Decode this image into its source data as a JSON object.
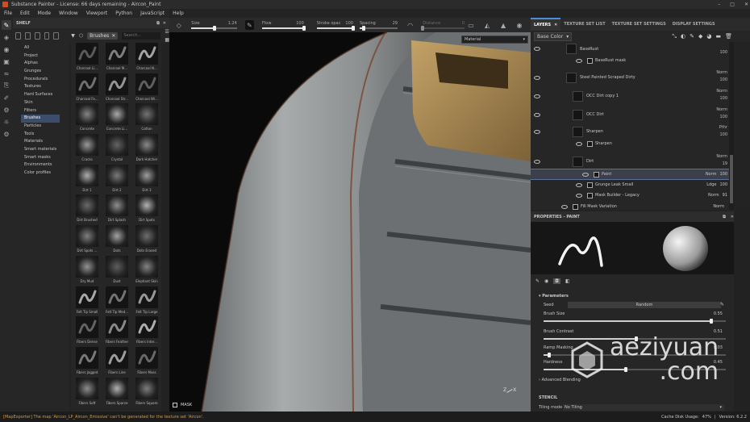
{
  "window": {
    "title": "Substance Painter - License: 66 days remaining - Aircon_Paint",
    "controls": [
      "–",
      "□",
      "✕"
    ]
  },
  "menu": [
    "File",
    "Edit",
    "Mode",
    "Window",
    "Viewport",
    "Python",
    "JavaScript",
    "Help"
  ],
  "toolbar": {
    "size": {
      "label": "Size",
      "value": "1.24",
      "fill": 0.5
    },
    "flow": {
      "label": "Flow",
      "value": "100",
      "fill": 1.0
    },
    "stroke_opacity": {
      "label": "Stroke opac",
      "value": "100",
      "fill": 1.0
    },
    "spacing": {
      "label": "Spacing",
      "value": "29",
      "fill": 0.1
    },
    "distance": {
      "label": "Distance",
      "value": "0",
      "fill": 0.0
    }
  },
  "shelf": {
    "title": "SHELF",
    "filter_chip": "Brushes",
    "search_placeholder": "Search...",
    "categories": [
      "All",
      "Project",
      "Alphas",
      "Grunges",
      "Procedurals",
      "Textures",
      "Hard Surfaces",
      "Skin",
      "Filters",
      "Brushes",
      "Particles",
      "Tools",
      "Materials",
      "Smart materials",
      "Smart masks",
      "Environments",
      "Color profiles"
    ],
    "selected_category": "Brushes",
    "brushes": [
      "Charcoal Li...",
      "Charcoal M...",
      "Charcoal N...",
      "Charcoal Fa...",
      "Charcoal Str...",
      "Charcoal Wi...",
      "Concrete",
      "Concrete Li...",
      "Cotton",
      "Cracks",
      "Crystal",
      "Dark Hatcher",
      "Dirt 1",
      "Dirt 2",
      "Dirt 3",
      "Dirt Brushed",
      "Dirt Splash",
      "Dirt Spots",
      "Dirt Spots ...",
      "Dots",
      "Dots Erased",
      "Dry Mud",
      "Dust",
      "Elephant Skin",
      "Felt Tip Small",
      "Felt Tip Med...",
      "Felt Tip Large",
      "Fibers Dense",
      "Fibers Feather",
      "Fibers Inter...",
      "Fibers Jagged",
      "Fibers Line",
      "Fibers Moss",
      "Fibers Soft",
      "Fibers Sparse",
      "Fibers Square"
    ]
  },
  "viewport": {
    "channel_select": "Material",
    "mask_label": "MASK",
    "axis_z": "Z",
    "axis_x": "X"
  },
  "layers_panel": {
    "tabs": [
      "LAYERS",
      "TEXTURE SET LIST",
      "TEXTURE SET SETTINGS",
      "DISPLAY SETTINGS"
    ],
    "channel": "Base Color",
    "layers": [
      {
        "name": "BaseRust",
        "mode": "",
        "opacity": "100"
      },
      {
        "name": "BaseRust mask",
        "mode": "",
        "opacity": ""
      },
      {
        "name": "Steel Painted Scraped Dirty",
        "mode": "Norm",
        "opacity": "100"
      },
      {
        "name": "OCC Dirt copy 1",
        "mode": "Norm",
        "opacity": "100"
      },
      {
        "name": "OCC Dirt",
        "mode": "Norm",
        "opacity": "100"
      },
      {
        "name": "Sharpen",
        "mode": "Pthr",
        "opacity": "100"
      },
      {
        "name": "Sharpen",
        "mode": "",
        "opacity": ""
      },
      {
        "name": "Dirt",
        "mode": "Norm",
        "opacity": "19"
      },
      {
        "name": "Paint",
        "mode": "Norm",
        "opacity": "100"
      },
      {
        "name": "Grunge Leak Small",
        "mode": "Ldge",
        "opacity": "100"
      },
      {
        "name": "Mask Builder - Legacy",
        "mode": "Norm",
        "opacity": "91"
      },
      {
        "name": "Fill Mask Variation",
        "mode": "Norm",
        "opacity": ""
      }
    ]
  },
  "properties": {
    "title": "PROPERTIES - PAINT",
    "section": "Parameters",
    "seed_label": "Seed",
    "seed_value": "Random",
    "params": [
      {
        "label": "Brush Size",
        "value": "0.55",
        "fill": 0.92
      },
      {
        "label": "Brush Contrast",
        "value": "0.51",
        "fill": 0.51
      },
      {
        "label": "Ramp Masking",
        "value": "0.03",
        "fill": 0.03
      },
      {
        "label": "Hardness",
        "value": "0.45",
        "fill": 0.45
      }
    ],
    "advanced": "Advanced Blending",
    "stencil": "STENCIL",
    "tiling_label": "Tiling mode",
    "tiling_value": "No Tiling"
  },
  "status": {
    "warning": "[MapExporter] The map 'Aircon_LP_Aircon_Emissive' can't be generated for the texture set 'Aircon'.",
    "cache": "Cache Disk Usage:",
    "cache_pct": "47%",
    "version": "Version: 6.2.2"
  },
  "watermark": {
    "line1": "aeziyuan",
    "line2": ".com"
  }
}
